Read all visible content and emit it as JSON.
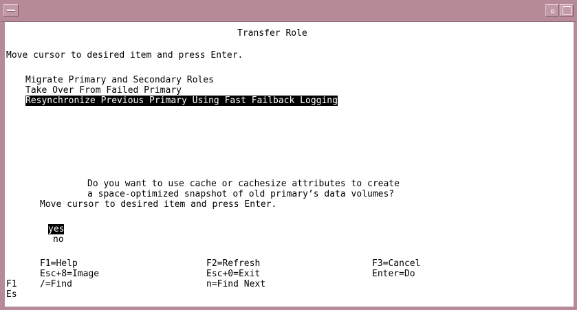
{
  "window": {
    "title": "",
    "accent_color": "#b78a98"
  },
  "screen": {
    "title": "Transfer Role",
    "instruction": "Move cursor to desired item and press Enter.",
    "menu": {
      "items": [
        {
          "label": "Migrate Primary and Secondary Roles",
          "selected": false
        },
        {
          "label": "Take Over From Failed Primary",
          "selected": false
        },
        {
          "label": "Resynchronize Previous Primary Using Fast Failback Logging",
          "selected": true
        }
      ]
    }
  },
  "dialog": {
    "question_line1": "Do you want to use cache or cachesize attributes to create",
    "question_line2": "a space-optimized snapshot of old primary’s data volumes?",
    "instruction": "Move cursor to desired item and press Enter.",
    "options": [
      {
        "label": "yes",
        "selected": true
      },
      {
        "label": "no",
        "selected": false
      }
    ],
    "keys": {
      "help": "F1=Help",
      "refresh": "F2=Refresh",
      "cancel": "F3=Cancel",
      "image": "Esc+8=Image",
      "exit": "Esc+0=Exit",
      "do": "Enter=Do",
      "find": "/=Find",
      "find_next": "n=Find Next"
    }
  },
  "background_fragments": {
    "f1": "F1",
    "es": "Es"
  }
}
